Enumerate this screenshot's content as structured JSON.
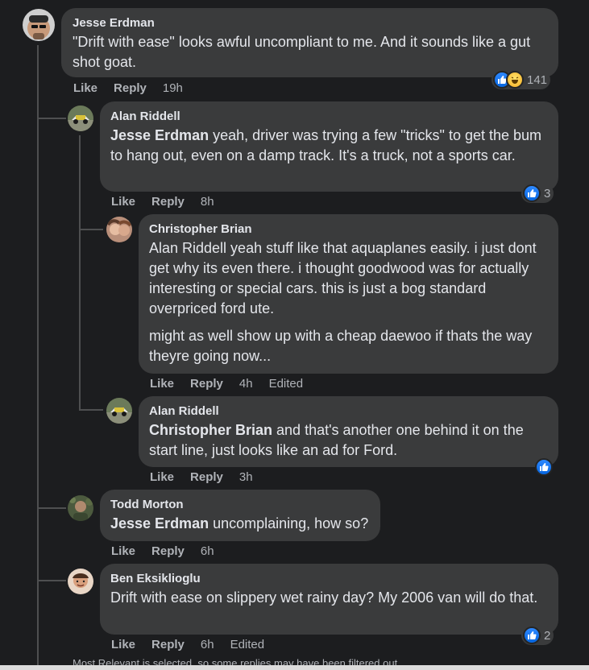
{
  "comments": [
    {
      "author": "Jesse Erdman",
      "text_lines": [
        "\"Drift with ease\" looks awful uncompliant to me. And it sounds like a gut shot goat."
      ],
      "like": "Like",
      "reply": "Reply",
      "time": "19h",
      "reaction_count": "141"
    },
    {
      "author": "Alan Riddell",
      "mention": "Jesse Erdman",
      "text": " yeah, driver was trying a few \"tricks\" to get the bum to hang out, even on a damp track. It's a truck, not a sports car.",
      "like": "Like",
      "reply": "Reply",
      "time": "8h",
      "reaction_count": "3"
    },
    {
      "author": "Christopher Brian",
      "para1": "Alan Riddell yeah stuff like that aquaplanes easily. i just dont get why its even there. i thought goodwood was for actually interesting or special cars. this is just a bog standard overpriced ford ute.",
      "para2": "might as well show up with a cheap daewoo if thats the way theyre going now...",
      "like": "Like",
      "reply": "Reply",
      "time": "4h",
      "edited": "Edited"
    },
    {
      "author": "Alan Riddell",
      "mention": "Christopher Brian",
      "text": " and that's another one behind it on the start line, just looks like an ad for Ford.",
      "like": "Like",
      "reply": "Reply",
      "time": "3h"
    },
    {
      "author": "Todd Morton",
      "mention": "Jesse Erdman",
      "text": " uncomplaining, how so?",
      "like": "Like",
      "reply": "Reply",
      "time": "6h"
    },
    {
      "author": "Ben Eksiklioglu",
      "text": "Drift with ease on slippery wet rainy day? My 2006 van will do that.",
      "like": "Like",
      "reply": "Reply",
      "time": "6h",
      "edited": "Edited",
      "reaction_count": "2"
    }
  ],
  "footer": "Most Relevant is selected, so some replies may have been filtered out.",
  "colors": {
    "like_blue": "#1877f2",
    "bubble": "#3a3b3c",
    "background": "#1c1d1f"
  }
}
